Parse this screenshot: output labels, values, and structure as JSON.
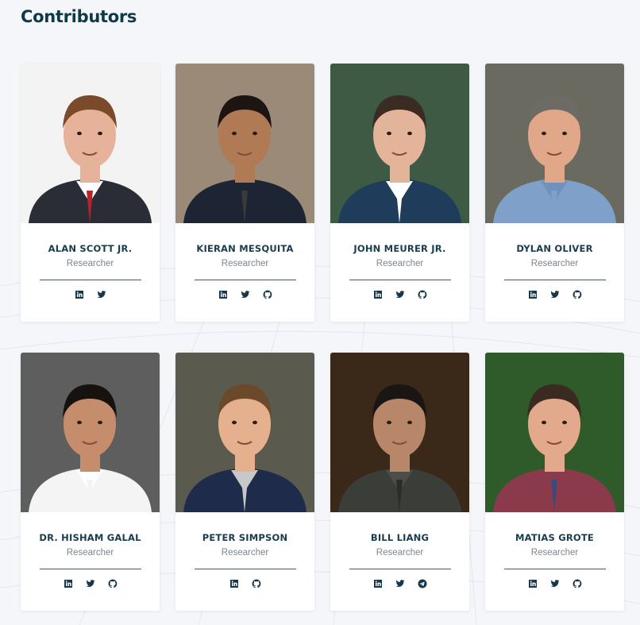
{
  "page": {
    "title": "Contributors"
  },
  "contributors": [
    {
      "name": "ALAN SCOTT JR.",
      "role": "Researcher",
      "socials": [
        "linkedin-icon",
        "twitter-icon"
      ],
      "photo": {
        "bg": "#f3f3f3",
        "skin": "#e6b39a",
        "hair": "#7a4a2a",
        "shirt": "#2a2d35",
        "accent": "#b3242d",
        "collar": "#ffffff"
      }
    },
    {
      "name": "KIERAN MESQUITA",
      "role": "Researcher",
      "socials": [
        "linkedin-icon",
        "twitter-icon",
        "github-icon"
      ],
      "photo": {
        "bg": "#9c8a78",
        "skin": "#b07a55",
        "hair": "#1c1512",
        "shirt": "#1d2535",
        "accent": "#3a3a3a",
        "collar": "#1d2535"
      }
    },
    {
      "name": "JOHN MEURER JR.",
      "role": "Researcher",
      "socials": [
        "linkedin-icon",
        "twitter-icon",
        "github-icon"
      ],
      "photo": {
        "bg": "#3e5a45",
        "skin": "#e3b49a",
        "hair": "#3a2c22",
        "shirt": "#1f3d5a",
        "accent": "#ffffff",
        "collar": "#ffffff"
      }
    },
    {
      "name": "DYLAN OLIVER",
      "role": "Researcher",
      "socials": [
        "linkedin-icon",
        "twitter-icon",
        "github-icon"
      ],
      "photo": {
        "bg": "#6a6a60",
        "skin": "#e0a888",
        "hair": "#6e6a66",
        "shirt": "#7fa0c8",
        "accent": "#7fa0c8",
        "collar": "#6f92bd"
      }
    },
    {
      "name": "DR. HISHAM GALAL",
      "role": "Researcher",
      "socials": [
        "linkedin-icon",
        "twitter-icon",
        "github-icon"
      ],
      "photo": {
        "bg": "#5e5e5e",
        "skin": "#c68d6c",
        "hair": "#151210",
        "shirt": "#f4f4f4",
        "accent": "#f4f4f4",
        "collar": "#ffffff"
      }
    },
    {
      "name": "PETER SIMPSON",
      "role": "Researcher",
      "socials": [
        "linkedin-icon",
        "github-icon"
      ],
      "photo": {
        "bg": "#5a5b4e",
        "skin": "#e4b08e",
        "hair": "#6b4a2c",
        "shirt": "#1e2b4a",
        "accent": "#c8c8c8",
        "collar": "#c8c8c8"
      }
    },
    {
      "name": "BILL LIANG",
      "role": "Researcher",
      "socials": [
        "linkedin-icon",
        "twitter-icon",
        "telegram-icon"
      ],
      "photo": {
        "bg": "#3a2818",
        "skin": "#b8876a",
        "hair": "#1a1614",
        "shirt": "#3a3d38",
        "accent": "#2a2d2a",
        "collar": "#4a4d48"
      }
    },
    {
      "name": "MATIAS GROTE",
      "role": "Researcher",
      "socials": [
        "linkedin-icon",
        "twitter-icon",
        "github-icon"
      ],
      "photo": {
        "bg": "#2f5a2a",
        "skin": "#e2a98c",
        "hair": "#3a2a20",
        "shirt": "#8a3a4a",
        "accent": "#3a4a7a",
        "collar": "#8a3a4a"
      }
    }
  ]
}
